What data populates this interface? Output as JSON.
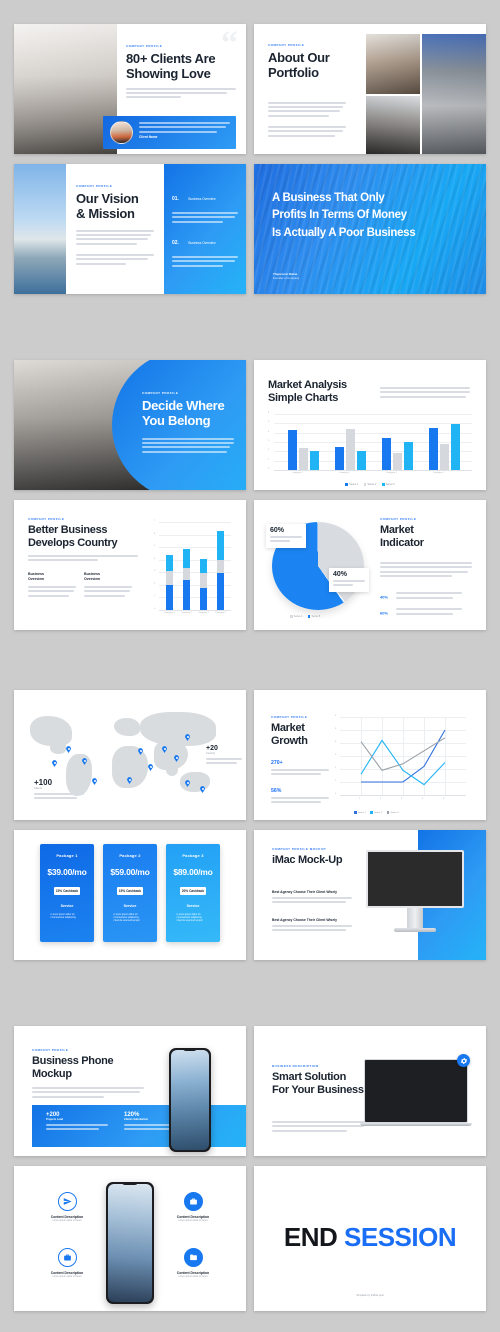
{
  "meta": {
    "background_color": "#cccccc",
    "accent_blue": "#1878f0",
    "accent_cyan": "#21b4f5",
    "text_dark": "#1b2430"
  },
  "slides": [
    {
      "id": "clients-love",
      "eyebrow": "COMPANY PROFILE",
      "title": "80+ Clients Are Showing Love",
      "title_lines": [
        "80+ Clients Are",
        "Showing Love"
      ],
      "quote_glyph": "“",
      "testimonial_name": "Client Name",
      "avatar": "client-avatar"
    },
    {
      "id": "about-portfolio",
      "eyebrow": "COMPANY PROFILE",
      "title": "About Our Portfolio",
      "title_lines": [
        "About Our",
        "Portfolio"
      ]
    },
    {
      "id": "vision-mission",
      "eyebrow": "COMPANY PROFILE",
      "title": "Our Vision & Mission",
      "title_lines": [
        "Our Vision",
        "& Mission"
      ],
      "items": [
        {
          "number": "01.",
          "label": "Business Overview"
        },
        {
          "number": "02.",
          "label": "Business Overview"
        }
      ]
    },
    {
      "id": "quote",
      "title_lines": [
        "A Business That Only",
        "Profits In Terms Of Money",
        "Is Actually A Poor Business"
      ],
      "author": "Theperson Name",
      "author_role": "Founder of Company"
    },
    {
      "id": "decide-belong",
      "eyebrow": "COMPANY PROFILE",
      "title": "Decide Where You Belong",
      "title_lines": [
        "Decide Where",
        "You Belong"
      ]
    },
    {
      "id": "market-analysis",
      "eyebrow": "",
      "title": "Market Analysis Simple Charts",
      "title_lines": [
        "Market Analysis",
        "Simple Charts"
      ]
    },
    {
      "id": "better-business",
      "eyebrow": "COMPANY PROFILE",
      "title": "Better Business Develops Country",
      "title_lines": [
        "Better Business",
        "Develops Country"
      ],
      "columns": [
        {
          "heading_lines": [
            "Business",
            "Overview"
          ]
        },
        {
          "heading_lines": [
            "Business",
            "Overview"
          ]
        }
      ]
    },
    {
      "id": "market-indicator",
      "eyebrow": "COMPANY PROFILE",
      "title": "Market Indicator",
      "title_lines": [
        "Market",
        "Indicator"
      ],
      "callouts": [
        {
          "value": "60%"
        },
        {
          "value": "40%"
        }
      ],
      "legend": [
        {
          "value": "40%"
        },
        {
          "value": "60%"
        }
      ]
    },
    {
      "id": "world-map",
      "stats": [
        {
          "value": "+100",
          "label": "Clients"
        },
        {
          "value": "+20",
          "label": "Country"
        }
      ]
    },
    {
      "id": "market-growth",
      "eyebrow": "COMPANY PROFILE",
      "title": "Market Growth",
      "title_lines": [
        "Market",
        "Growth"
      ],
      "stats": [
        {
          "value": "270+"
        },
        {
          "value": "56%"
        }
      ]
    },
    {
      "id": "pricing",
      "packages": [
        {
          "name": "Package 1",
          "price": "$39.00/mo",
          "badge": "15% Cashback",
          "service_label": "Service",
          "features": 2
        },
        {
          "name": "Package 2",
          "price": "$59.00/mo",
          "badge": "15% Cashback",
          "service_label": "Service",
          "features": 3
        },
        {
          "name": "Package 3",
          "price": "$89.00/mo",
          "badge": "20% Cashback",
          "service_label": "Service",
          "features": 3
        }
      ]
    },
    {
      "id": "imac-mockup",
      "eyebrow": "COMPANY PROFILE MOCKUP",
      "title": "iMac Mock-Up",
      "points": [
        {
          "heading": "Best Agency Choose Their Client Wisely"
        },
        {
          "heading": "Best Agency Choose Their Client Wisely"
        }
      ]
    },
    {
      "id": "phone-mockup",
      "eyebrow": "COMPANY PROFILE",
      "title": "Business Phone Mockup",
      "title_lines": [
        "Business Phone",
        "Mockup"
      ],
      "stats": [
        {
          "value": "+200",
          "label": "Projects Lead"
        },
        {
          "value": "120%",
          "label": "Clients Satisfaction"
        }
      ]
    },
    {
      "id": "smart-solution",
      "eyebrow": "Business Description",
      "title": "Smart Solution For Your Business",
      "title_lines": [
        "Smart Solution",
        "For Your Business"
      ],
      "badge_icon": "gear-icon"
    },
    {
      "id": "content-grid",
      "items": [
        {
          "icon": "paper-plane-icon",
          "label": "Content Description",
          "sub": "Lorem ipsum dolor sit amet"
        },
        {
          "icon": "toolbox-icon",
          "label": "Content Description",
          "sub": "Lorem ipsum dolor sit amet"
        },
        {
          "icon": "briefcase-icon",
          "label": "Content Description",
          "sub": "Lorem ipsum dolor sit amet"
        },
        {
          "icon": "folder-icon",
          "label": "Content Description",
          "sub": "Lorem ipsum dolor sit amet"
        }
      ]
    },
    {
      "id": "end-session",
      "title_part1": "END ",
      "title_part2": "SESSION",
      "footer": "Template by 4Slide.post"
    }
  ],
  "chart_data": [
    {
      "type": "bar",
      "slide": "market-analysis",
      "title": "Market Analysis Simple Charts",
      "categories": [
        "Category 1",
        "Category 2",
        "Category 3",
        "Category 4"
      ],
      "series": [
        {
          "name": "Series 1",
          "color": "#1878f0",
          "values": [
            4.3,
            2.5,
            3.5,
            4.5
          ]
        },
        {
          "name": "Series 2",
          "color": "#d5d8dc",
          "values": [
            2.4,
            4.4,
            1.8,
            2.8
          ]
        },
        {
          "name": "Series 3",
          "color": "#21b4f5",
          "values": [
            2.0,
            2.0,
            3.0,
            5.0
          ]
        }
      ],
      "ylim": [
        0,
        6
      ],
      "yticks": [
        0,
        1,
        2,
        3,
        4,
        5,
        6
      ],
      "xlabel": "",
      "ylabel": "",
      "grid": true,
      "legend": "bottom"
    },
    {
      "type": "bar",
      "slide": "better-business",
      "title": "Better Business Develops Country",
      "stacked": true,
      "categories": [
        "Category 1",
        "Category 2",
        "Category 3",
        "Category 4"
      ],
      "series": [
        {
          "name": "Series 1",
          "color": "#1878f0",
          "values": [
            2.0,
            2.4,
            1.8,
            3.0
          ]
        },
        {
          "name": "Series 2",
          "color": "#d5d8dc",
          "values": [
            1.1,
            1.0,
            1.2,
            1.0
          ]
        },
        {
          "name": "Series 3",
          "color": "#21b4f5",
          "values": [
            1.3,
            1.5,
            1.1,
            2.3
          ]
        }
      ],
      "ylim": [
        0,
        7
      ],
      "yticks": [
        0,
        1,
        2,
        3,
        4,
        5,
        6,
        7
      ],
      "grid": true
    },
    {
      "type": "pie",
      "slide": "market-indicator",
      "title": "Market Indicator",
      "labels": [
        "Series A",
        "Series B"
      ],
      "values": [
        60,
        40
      ],
      "colors": [
        "#1b84f2",
        "#d8dbdf"
      ],
      "data_labels": [
        "60%",
        "40%"
      ]
    },
    {
      "type": "line",
      "slide": "market-growth",
      "title": "Market Growth",
      "x": [
        "1",
        "2",
        "3",
        "4",
        "5"
      ],
      "series": [
        {
          "name": "Series 1",
          "color": "#2f6fe0",
          "values": [
            1.0,
            1.0,
            1.0,
            2.2,
            5.0
          ]
        },
        {
          "name": "Series 2",
          "color": "#21b4f5",
          "values": [
            1.6,
            4.2,
            1.9,
            0.8,
            2.5
          ]
        },
        {
          "name": "Series 3",
          "color": "#9aa1a9",
          "values": [
            4.1,
            1.9,
            2.4,
            3.4,
            4.4
          ]
        }
      ],
      "ylim": [
        0,
        6
      ],
      "yticks": [
        0,
        1,
        2,
        3,
        4,
        5,
        6
      ],
      "grid": true,
      "legend": "bottom"
    }
  ]
}
